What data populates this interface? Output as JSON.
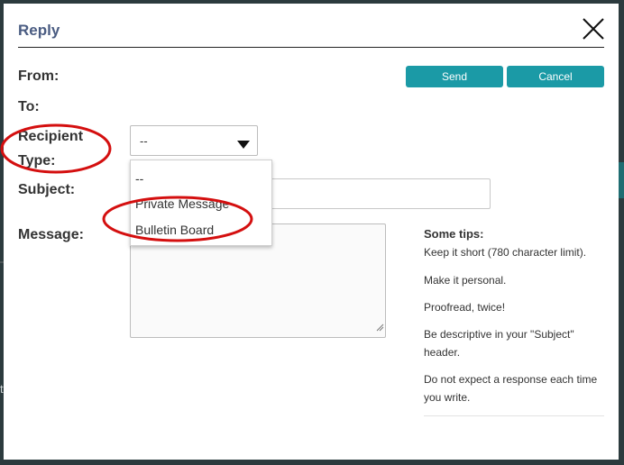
{
  "dialog": {
    "title": "Reply",
    "close_icon": "close-icon"
  },
  "form": {
    "from_label": "From:",
    "to_label": "To:",
    "recipient_type_label_line1": "Recipient",
    "recipient_type_label_line2": "Type:",
    "subject_label": "Subject:",
    "message_label": "Message:",
    "recipient_type_value": "--",
    "subject_value": "",
    "message_value": ""
  },
  "buttons": {
    "send": "Send",
    "cancel": "Cancel"
  },
  "dropdown": {
    "options": [
      "--",
      "Private Message",
      "Bulletin Board"
    ]
  },
  "tips": {
    "title": "Some tips:",
    "items": [
      "Keep it short (780 character limit).",
      "Make it personal.",
      "Proofread, twice!",
      "Be descriptive in your \"Subject\" header.",
      "Do not expect a response each time you write."
    ]
  },
  "colors": {
    "accent": "#1b9aa6",
    "title": "#4a5c82",
    "annotation": "#d40f0f",
    "backdrop": "#2c3b3e"
  }
}
